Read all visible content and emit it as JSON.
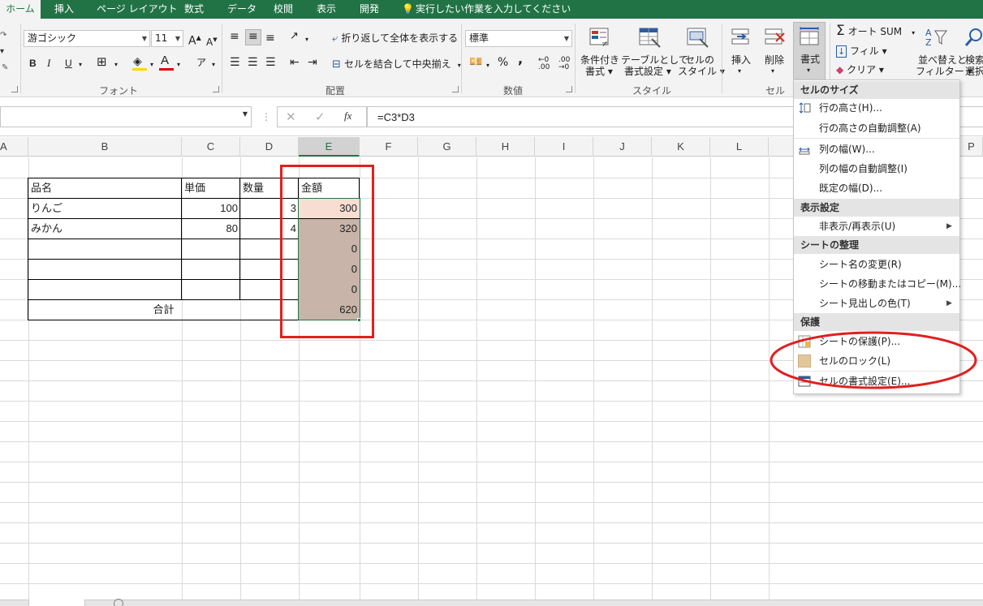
{
  "tabs": [
    "ホーム",
    "挿入",
    "ページ レイアウト",
    "数式",
    "データ",
    "校閲",
    "表示",
    "開発"
  ],
  "tell_me": "実行したい作業を入力してください",
  "font": {
    "name": "游ゴシック",
    "size": "11",
    "bold": "B",
    "italic": "I",
    "underline": "U"
  },
  "groups": {
    "font": "フォント",
    "alignment": "配置",
    "number": "数値",
    "styles": "スタイル",
    "cells": "セル"
  },
  "alignment": {
    "wrap": "折り返して全体を表示する",
    "merge": "セルを結合して中央揃え"
  },
  "number": {
    "format": "標準",
    "percent": "%",
    "comma": ","
  },
  "styles": {
    "conditional": "条件付き",
    "conditional2": "書式 ▾",
    "table": "テーブルとして",
    "table2": "書式設定 ▾",
    "cellstyle": "セルの",
    "cellstyle2": "スタイル ▾"
  },
  "cells": {
    "insert": "挿入",
    "delete": "削除",
    "format": "書式"
  },
  "editing": {
    "autosum": "オート SUM",
    "fill": "フィル ▾",
    "clear": "クリア ▾",
    "sort": "並べ替えと",
    "sort2": "フィルター ▾",
    "find": "検索",
    "find2": "選択"
  },
  "formula": "=C3*D3",
  "fx": "fx",
  "columns": [
    "A",
    "B",
    "C",
    "D",
    "E",
    "F",
    "G",
    "H",
    "I",
    "J",
    "K",
    "L",
    "P"
  ],
  "table": {
    "header": {
      "name": "品名",
      "price": "単価",
      "qty": "数量",
      "amount": "金額"
    },
    "rows": [
      {
        "name": "りんご",
        "price": "100",
        "qty": "3",
        "amount": "300"
      },
      {
        "name": "みかん",
        "price": "80",
        "qty": "4",
        "amount": "320"
      },
      {
        "name": "",
        "price": "",
        "qty": "",
        "amount": "0"
      },
      {
        "name": "",
        "price": "",
        "qty": "",
        "amount": "0"
      },
      {
        "name": "",
        "price": "",
        "qty": "",
        "amount": "0"
      }
    ],
    "total_label": "合計",
    "total": "620"
  },
  "menu": {
    "sec1": "セルのサイズ",
    "row_height": "行の高さ(H)...",
    "row_auto": "行の高さの自動調整(A)",
    "col_width": "列の幅(W)...",
    "col_auto": "列の幅の自動調整(I)",
    "default_width": "既定の幅(D)...",
    "sec2": "表示設定",
    "hide": "非表示/再表示(U)",
    "sec3": "シートの整理",
    "rename": "シート名の変更(R)",
    "move": "シートの移動またはコピー(M)...",
    "tabcolor": "シート見出しの色(T)",
    "sec4": "保護",
    "protect": "シートの保護(P)...",
    "lock": "セルのロック(L)",
    "format_cells": "セルの書式設定(E)..."
  },
  "colors": {
    "accent": "#217346",
    "highlight": "#e02020",
    "shade": "#c8b4a8"
  }
}
